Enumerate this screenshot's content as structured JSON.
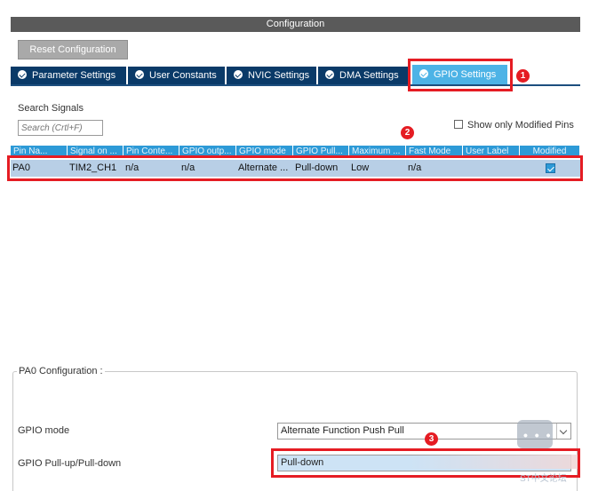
{
  "window": {
    "title": "Configuration"
  },
  "reset_button": {
    "label": "Reset Configuration"
  },
  "tabs": [
    {
      "label": "Parameter Settings"
    },
    {
      "label": "User Constants"
    },
    {
      "label": "NVIC Settings"
    },
    {
      "label": "DMA Settings"
    },
    {
      "label": "GPIO Settings",
      "active": true
    }
  ],
  "markers": [
    "1",
    "2",
    "3"
  ],
  "search": {
    "label": "Search Signals",
    "placeholder": "Search (Crtl+F)"
  },
  "show_modified": {
    "label": "Show only Modified Pins",
    "checked": false
  },
  "table": {
    "headers": [
      "Pin Na...",
      "Signal on ...",
      "Pin Conte...",
      "GPIO outp...",
      "GPIO mode",
      "GPIO Pull...",
      "Maximum ...",
      "Fast Mode",
      "User Label",
      "Modified"
    ],
    "rows": [
      {
        "pin": "PA0",
        "signal": "TIM2_CH1",
        "context": "n/a",
        "output": "n/a",
        "mode": "Alternate ...",
        "pull": "Pull-down",
        "speed": "Low",
        "fast": "n/a",
        "label": "",
        "modified": true
      }
    ]
  },
  "config": {
    "legend": "PA0 Configuration :",
    "gpio_mode": {
      "label": "GPIO mode",
      "value": "Alternate Function Push Pull"
    },
    "gpio_pull": {
      "label": "GPIO Pull-up/Pull-down",
      "value": "Pull-down"
    }
  },
  "watermark": {
    "text": "ST中文论坛"
  },
  "colors": {
    "accent": "#e51c23",
    "tab_bg": "#0a3a68",
    "tab_active": "#4db3e6",
    "header_bg": "#2d9ad7",
    "row_selected": "#b8cfe6"
  }
}
